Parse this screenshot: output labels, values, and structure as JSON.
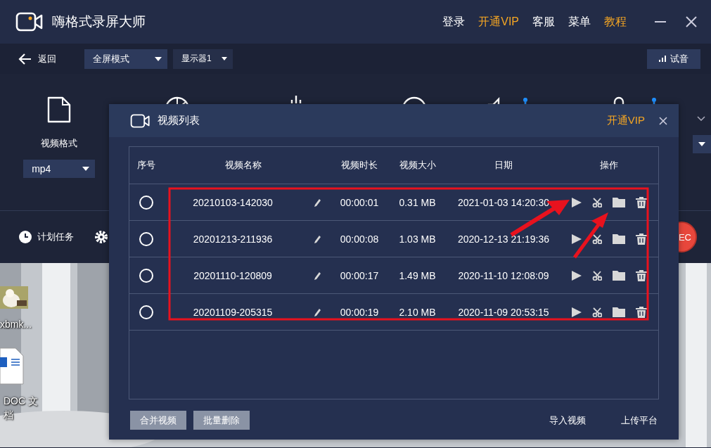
{
  "app": {
    "title": "嗨格式录屏大师",
    "nav": [
      {
        "label": "登录",
        "highlight": false
      },
      {
        "label": "开通VIP",
        "highlight": true
      },
      {
        "label": "客服",
        "highlight": false
      },
      {
        "label": "菜单",
        "highlight": false
      },
      {
        "label": "教程",
        "highlight": true
      }
    ]
  },
  "toolbar": {
    "back": "返回",
    "mode": "全屏模式",
    "display": "显示器1",
    "sound_test": "试音"
  },
  "settings": {
    "format_label": "视频格式",
    "format_value": "mp4",
    "speaker_slider": {
      "level": 1
    },
    "mic_slider": {
      "level": 1
    }
  },
  "bottom_bar": {
    "schedule": "计划任务",
    "record": "EC"
  },
  "desktop_icons": [
    {
      "label": "xbmk...",
      "kind": "picture"
    },
    {
      "label": "DOC 文档",
      "kind": "document"
    }
  ],
  "dialog": {
    "title": "视频列表",
    "vip": "开通VIP",
    "columns": [
      "序号",
      "视频名称",
      "视频时长",
      "视频大小",
      "日期",
      "操作"
    ],
    "rows": [
      {
        "selected": false,
        "name": "20210103-142030",
        "duration": "00:00:01",
        "size": "0.31 MB",
        "date": "2021-01-03 14:20:30"
      },
      {
        "selected": false,
        "name": "20201213-211936",
        "duration": "00:00:08",
        "size": "1.03 MB",
        "date": "2020-12-13 21:19:36"
      },
      {
        "selected": false,
        "name": "20201110-120809",
        "duration": "00:00:17",
        "size": "1.49 MB",
        "date": "2020-11-10 12:08:09"
      },
      {
        "selected": false,
        "name": "20201109-205315",
        "duration": "00:00:19",
        "size": "2.10 MB",
        "date": "2020-11-09 20:53:15"
      }
    ],
    "buttons": [
      "合并视频",
      "批量删除"
    ],
    "links": [
      "导入视频",
      "上传平台"
    ]
  }
}
